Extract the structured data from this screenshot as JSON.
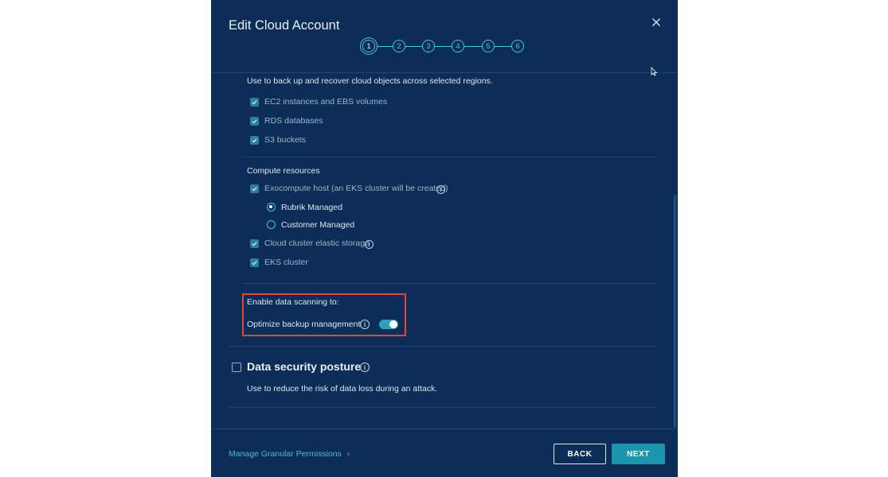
{
  "modal": {
    "title": "Edit Cloud Account",
    "close_icon": "close-icon",
    "steps": [
      "1",
      "2",
      "3",
      "4",
      "5",
      "6"
    ],
    "active_step": "1"
  },
  "protection": {
    "description": "Use to back up and recover cloud objects across selected regions.",
    "items": [
      {
        "label": "EC2 instances and EBS volumes",
        "checked": true
      },
      {
        "label": "RDS databases",
        "checked": true
      },
      {
        "label": "S3 buckets",
        "checked": true
      }
    ]
  },
  "compute": {
    "heading": "Compute resources",
    "exocompute_label": "Exocompute host (an EKS cluster will be created)",
    "radio_options": [
      {
        "label": "Rubrik Managed",
        "selected": true
      },
      {
        "label": "Customer Managed",
        "selected": false
      }
    ],
    "elastic_storage_label": "Cloud cluster elastic storage",
    "eks_label": "EKS cluster"
  },
  "scanning": {
    "heading": "Enable data scanning to:",
    "optimize_label": "Optimize backup management",
    "optimize_enabled": true
  },
  "security": {
    "heading": "Data security posture",
    "description": "Use to reduce the risk of data loss during an attack.",
    "checked": false
  },
  "footer": {
    "link": "Manage Granular Permissions",
    "back_label": "BACK",
    "next_label": "NEXT"
  },
  "colors": {
    "background": "#0c2d57",
    "accent": "#3ec7d9",
    "button": "#1a95ad",
    "highlight": "#e2453c"
  }
}
